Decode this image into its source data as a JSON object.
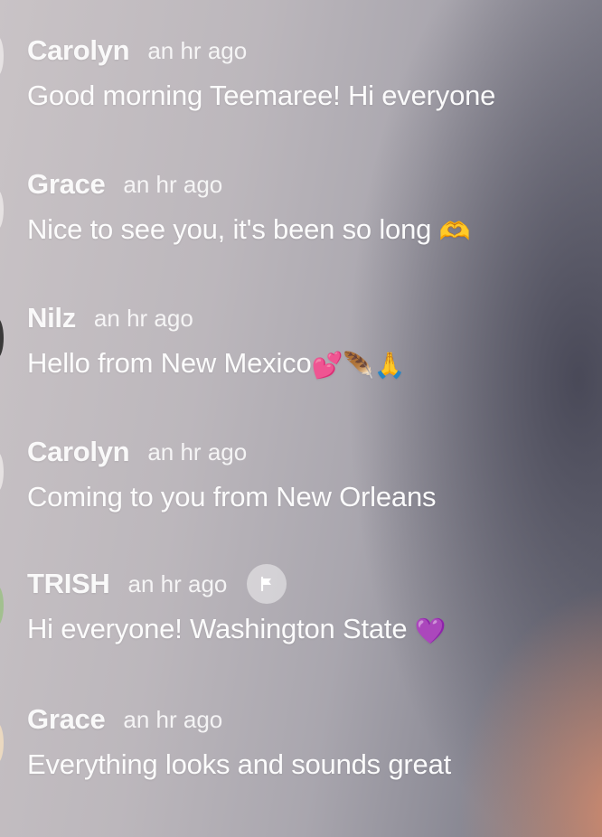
{
  "messages": [
    {
      "name": "Carolyn",
      "time": "an hr ago",
      "text": "Good morning Teemaree! Hi everyone",
      "emojis": []
    },
    {
      "name": "Grace",
      "time": "an hr ago",
      "text": "Nice to see you, it's been so long ",
      "emojis": [
        {
          "icon": "heart-hands-emoji",
          "glyph": "🫶"
        }
      ]
    },
    {
      "name": "Nilz",
      "time": "an hr ago",
      "text": "Hello from New Mexico",
      "emojis": [
        {
          "icon": "two-hearts-emoji",
          "glyph": "💕"
        },
        {
          "icon": "feather-emoji",
          "glyph": "🪶"
        },
        {
          "icon": "folded-hands-emoji",
          "glyph": "🙏"
        }
      ]
    },
    {
      "name": "Carolyn",
      "time": "an hr ago",
      "text": "Coming to you from New Orleans",
      "emojis": []
    },
    {
      "name": "TRISH",
      "time": "an hr ago",
      "text": "Hi everyone! Washington State ",
      "emojis": [
        {
          "icon": "purple-heart-emoji",
          "glyph": "💜"
        }
      ],
      "flag_button": "flag-icon"
    },
    {
      "name": "Grace",
      "time": "an hr ago",
      "text": "Everything looks and sounds great",
      "emojis": []
    }
  ]
}
